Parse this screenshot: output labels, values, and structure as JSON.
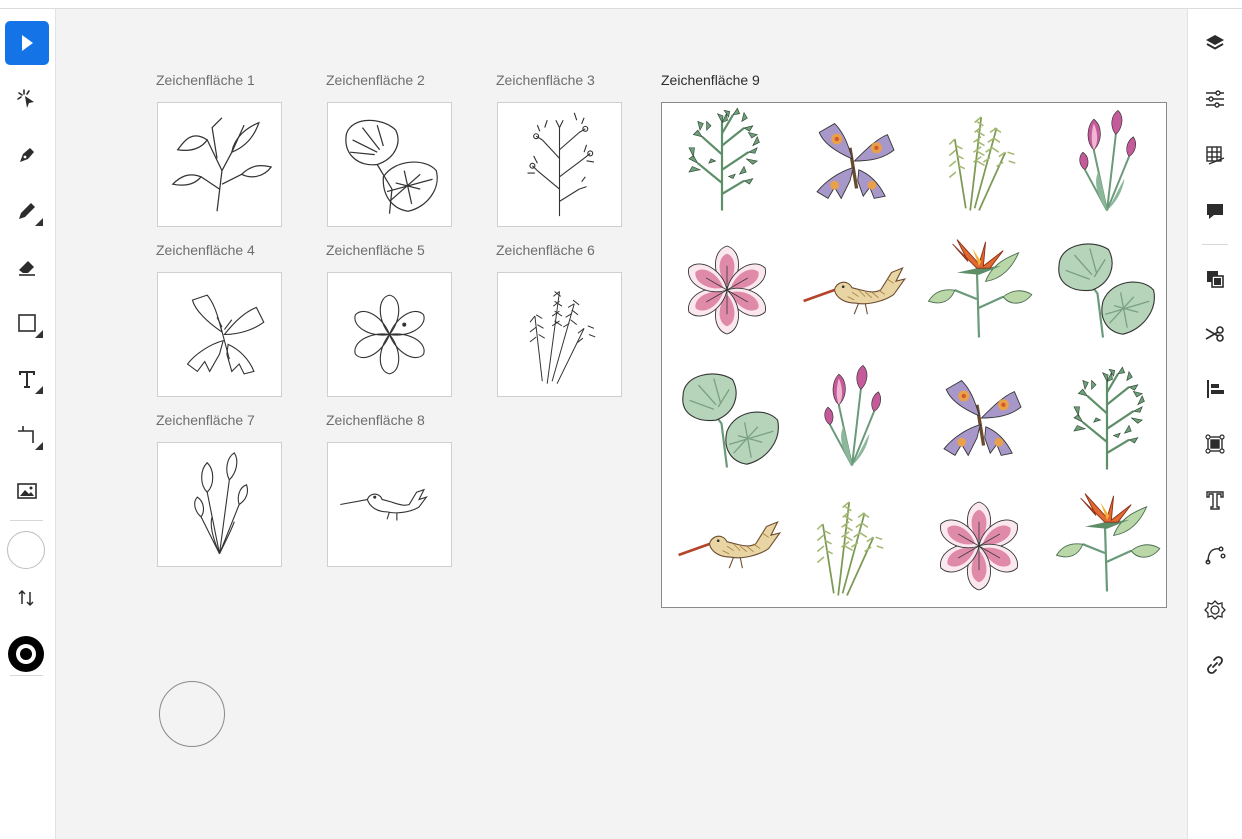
{
  "left_toolbar": {
    "tools": [
      {
        "name": "selection-tool",
        "icon": "arrow-icon",
        "active": true
      },
      {
        "name": "direct-selection-tool",
        "icon": "magic-selection-icon"
      },
      {
        "name": "pen-tool",
        "icon": "pen-icon"
      },
      {
        "name": "pencil-tool",
        "icon": "pencil-icon"
      },
      {
        "name": "eraser-tool",
        "icon": "eraser-icon"
      },
      {
        "name": "rectangle-tool",
        "icon": "rectangle-icon"
      },
      {
        "name": "type-tool",
        "icon": "type-icon"
      },
      {
        "name": "artboard-tool",
        "icon": "artboard-icon"
      },
      {
        "name": "place-image-tool",
        "icon": "image-icon"
      }
    ],
    "fill_color": "#ffffff",
    "stroke_color": "#000000"
  },
  "right_panel": {
    "icons": [
      "layers-icon",
      "properties-icon",
      "libraries-icon",
      "comments-icon",
      "arrange-icon",
      "repeat-grid-icon",
      "align-icon",
      "transform-icon",
      "type-panel-icon",
      "path-icon",
      "symbols-icon",
      "link-icon"
    ]
  },
  "artboards": [
    {
      "label": "Zeichenfläche 1",
      "art": "flower-stem"
    },
    {
      "label": "Zeichenfläche 2",
      "art": "monstera"
    },
    {
      "label": "Zeichenfläche 3",
      "art": "herb"
    },
    {
      "label": "Zeichenfläche 4",
      "art": "butterfly"
    },
    {
      "label": "Zeichenfläche 5",
      "art": "flower"
    },
    {
      "label": "Zeichenfläche 6",
      "art": "rosemary"
    },
    {
      "label": "Zeichenfläche 7",
      "art": "tulips"
    },
    {
      "label": "Zeichenfläche 8",
      "art": "bird"
    }
  ],
  "main_artboard": {
    "label": "Zeichenfläche 9",
    "grid": [
      "herb",
      "butterfly",
      "rosemary",
      "tulips",
      "flower",
      "bird",
      "strelitzia",
      "monstera",
      "monstera",
      "tulips",
      "butterfly",
      "herb",
      "bird",
      "rosemary",
      "flower",
      "strelitzia"
    ]
  },
  "colors": {
    "accent": "#1473e6",
    "leaf": "#6f9e7c",
    "pink": "#d98aa8",
    "orange": "#e0692f",
    "purple": "#9b86b8",
    "bird": "#c9a45a"
  }
}
